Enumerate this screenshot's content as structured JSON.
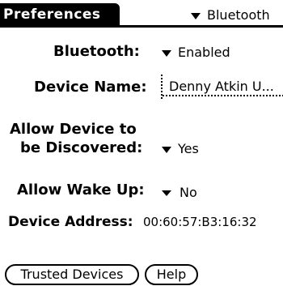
{
  "title": "Preferences",
  "category_picker": {
    "label": "Bluetooth"
  },
  "fields": {
    "bluetooth": {
      "label": "Bluetooth:",
      "value": "Enabled"
    },
    "device_name": {
      "label": "Device Name:",
      "value": "Denny Atkin U..."
    },
    "discoverable": {
      "label_line1": "Allow Device to",
      "label_line2": "be Discovered:",
      "value": "Yes"
    },
    "wake_up": {
      "label": "Allow Wake Up:",
      "value": "No"
    },
    "device_address": {
      "label": "Device Address:",
      "value": "00:60:57:B3:16:32"
    }
  },
  "buttons": {
    "trusted_devices": "Trusted Devices",
    "help": "Help"
  }
}
